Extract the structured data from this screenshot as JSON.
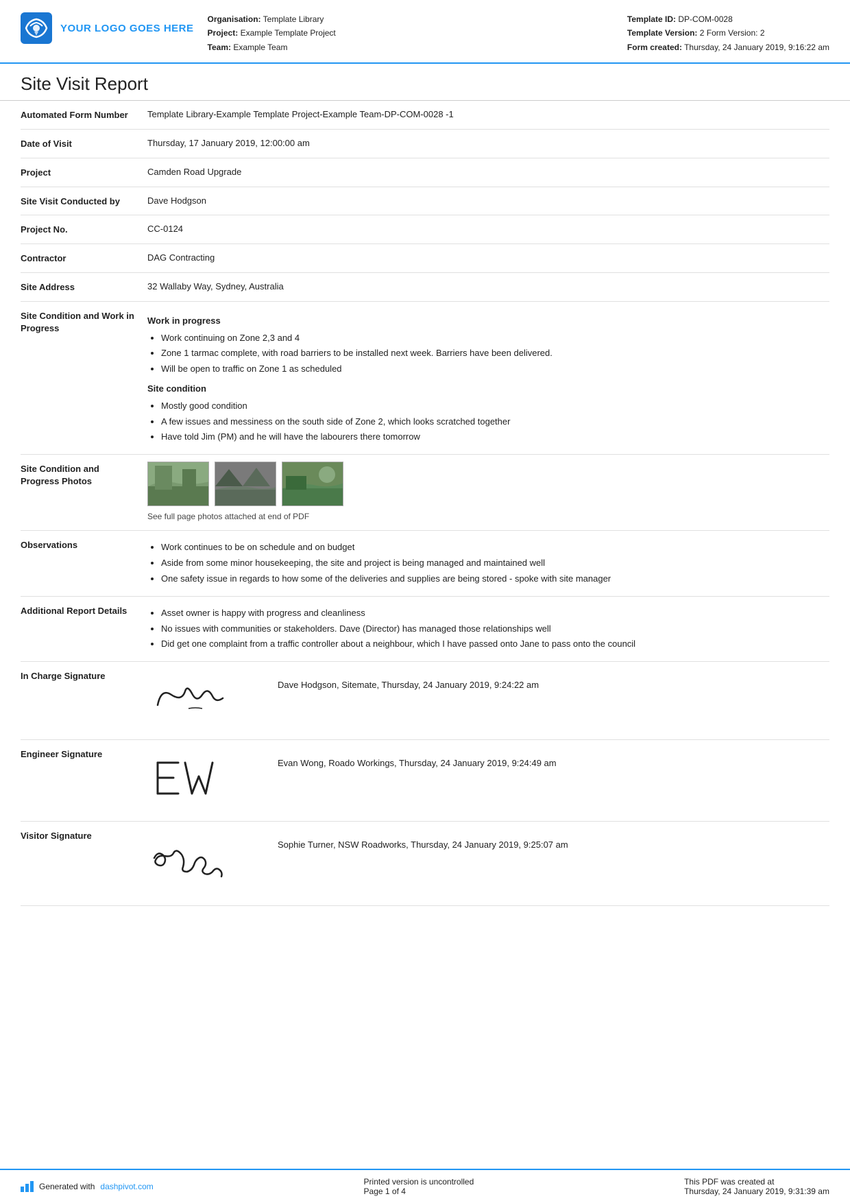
{
  "header": {
    "logo_text": "YOUR LOGO GOES HERE",
    "organisation_label": "Organisation:",
    "organisation_value": "Template Library",
    "project_label": "Project:",
    "project_value": "Example Template Project",
    "team_label": "Team:",
    "team_value": "Example Team",
    "template_id_label": "Template ID:",
    "template_id_value": "DP-COM-0028",
    "template_version_label": "Template Version:",
    "template_version_value": "2",
    "form_version_label": "Form Version:",
    "form_version_value": "2",
    "form_created_label": "Form created:",
    "form_created_value": "Thursday, 24 January 2019, 9:16:22 am"
  },
  "page_title": "Site Visit Report",
  "fields": {
    "automated_form_number_label": "Automated Form Number",
    "automated_form_number_value": "Template Library-Example Template Project-Example Team-DP-COM-0028   -1",
    "date_of_visit_label": "Date of Visit",
    "date_of_visit_value": "Thursday, 17 January 2019, 12:00:00 am",
    "project_label": "Project",
    "project_value": "Camden Road Upgrade",
    "site_visit_conducted_by_label": "Site Visit Conducted by",
    "site_visit_conducted_by_value": "Dave Hodgson",
    "project_no_label": "Project No.",
    "project_no_value": "CC-0124",
    "contractor_label": "Contractor",
    "contractor_value": "DAG Contracting",
    "site_address_label": "Site Address",
    "site_address_value": "32 Wallaby Way, Sydney, Australia",
    "site_condition_label": "Site Condition and Work in Progress",
    "site_condition_heading1": "Work in progress",
    "site_condition_bullets1": [
      "Work continuing on Zone 2,3 and 4",
      "Zone 1 tarmac complete, with road barriers to be installed next week. Barriers have been delivered.",
      "Will be open to traffic on Zone 1 as scheduled"
    ],
    "site_condition_heading2": "Site condition",
    "site_condition_bullets2": [
      "Mostly good condition",
      "A few issues and messiness on the south side of Zone 2, which looks scratched together",
      "Have told Jim (PM) and he will have the labourers there tomorrow"
    ],
    "photos_label": "Site Condition and Progress Photos",
    "photos_caption": "See full page photos attached at end of PDF",
    "observations_label": "Observations",
    "observations_bullets": [
      "Work continues to be on schedule and on budget",
      "Aside from some minor housekeeping, the site and project is being managed and maintained well",
      "One safety issue in regards to how some of the deliveries and supplies are being stored - spoke with site manager"
    ],
    "additional_label": "Additional Report Details",
    "additional_bullets": [
      "Asset owner is happy with progress and cleanliness",
      "No issues with communities or stakeholders. Dave (Director) has managed those relationships well",
      "Did get one complaint from a traffic controller about a neighbour, which I have passed onto Jane to pass onto the council"
    ],
    "in_charge_sig_label": "In Charge Signature",
    "in_charge_sig_text": "Dave Hodgson, Sitemate, Thursday, 24 January 2019, 9:24:22 am",
    "in_charge_sig_display": "Camm",
    "engineer_sig_label": "Engineer Signature",
    "engineer_sig_text": "Evan Wong, Roado Workings, Thursday, 24 January 2019, 9:24:49 am",
    "engineer_sig_display": "EW",
    "visitor_sig_label": "Visitor Signature",
    "visitor_sig_text": "Sophie Turner, NSW Roadworks, Thursday, 24 January 2019, 9:25:07 am",
    "visitor_sig_display": "Sophie"
  },
  "footer": {
    "generated_text": "Generated with ",
    "generated_link": "dashpivot.com",
    "uncontrolled_text": "Printed version is uncontrolled",
    "page_label": "Page ",
    "page_number": "1",
    "page_of": " of 4",
    "pdf_created_label": "This PDF was created at",
    "pdf_created_value": "Thursday, 24 January 2019, 9:31:39 am"
  }
}
